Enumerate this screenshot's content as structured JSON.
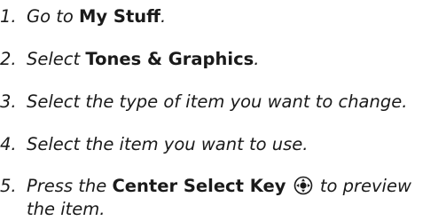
{
  "steps": [
    {
      "number": "1.",
      "before": "Go to",
      "bold": "My Stuff",
      "after": "."
    },
    {
      "number": "2.",
      "before": "Select",
      "bold": "Tones & Graphics",
      "after": "."
    },
    {
      "number": "3.",
      "text": "Select the type of item you want to change."
    },
    {
      "number": "4.",
      "text": "Select the item you want to use."
    },
    {
      "number": "5.",
      "before": "Press the",
      "bold": "Center Select Key",
      "icon": "center-select-key-icon",
      "after": "to preview",
      "continuation": "the item."
    }
  ]
}
